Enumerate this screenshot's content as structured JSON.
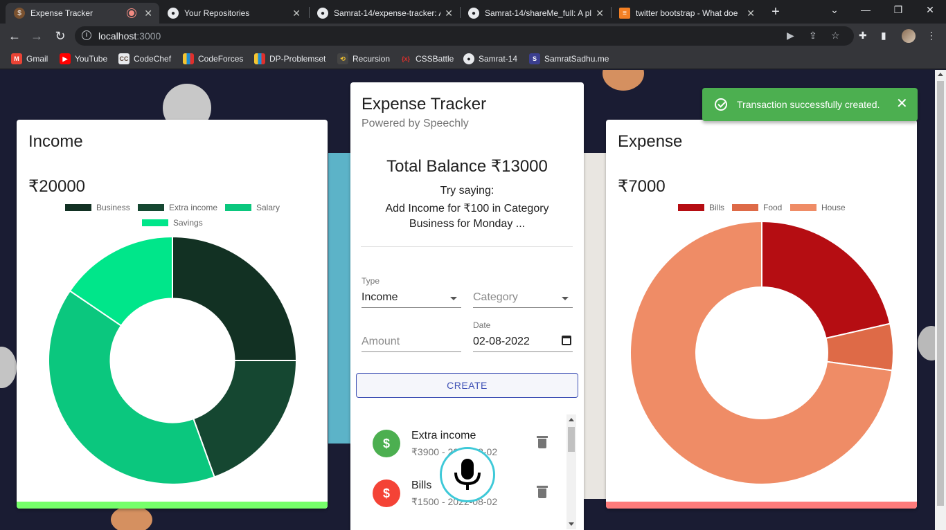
{
  "browser": {
    "tabs": [
      {
        "title": "Expense Tracker",
        "active": true
      },
      {
        "title": "Your Repositories"
      },
      {
        "title": "Samrat-14/expense-tracker: A"
      },
      {
        "title": "Samrat-14/shareMe_full: A pl"
      },
      {
        "title": "twitter bootstrap - What doe"
      }
    ],
    "url_host": "localhost",
    "url_port": ":3000",
    "bookmarks": [
      "Gmail",
      "YouTube",
      "CodeChef",
      "CodeForces",
      "DP-Problemset",
      "Recursion",
      "CSSBattle",
      "Samrat-14",
      "SamratSadhu.me"
    ]
  },
  "income": {
    "title": "Income",
    "amount": "₹20000",
    "bar_color": "#76ff6a"
  },
  "expense": {
    "title": "Expense",
    "amount": "₹7000",
    "bar_color": "#ff7b7b"
  },
  "main": {
    "title": "Expense Tracker",
    "subtitle": "Powered by Speechly",
    "balance": "Total Balance ₹13000",
    "try_line1": "Try saying:",
    "try_line2": "Add Income for ₹100 in Category",
    "try_line3": "Business for Monday ...",
    "type_label": "Type",
    "type_value": "Income",
    "category_placeholder": "Category",
    "amount_placeholder": "Amount",
    "date_label": "Date",
    "date_value": "02-08-2022",
    "create_label": "CREATE",
    "transactions": [
      {
        "name": "Extra income",
        "meta": "₹3900 - 2022-08-02",
        "color": "#4caf50",
        "icon": "dollar-off-icon"
      },
      {
        "name": "Bills",
        "meta": "₹1500 - 2022-08-02",
        "color": "#f44336",
        "icon": "dollar-off-icon"
      }
    ]
  },
  "snackbar": {
    "message": "Transaction successfully created."
  },
  "chart_data": [
    {
      "type": "pie",
      "title": "Income",
      "categories": [
        "Business",
        "Extra income",
        "Salary",
        "Savings"
      ],
      "values": [
        5000,
        3900,
        8000,
        3100
      ],
      "colors": [
        "#123123",
        "#154731",
        "#0bc77e",
        "#00e68a"
      ]
    },
    {
      "type": "pie",
      "title": "Expense",
      "categories": [
        "Bills",
        "Food",
        "House"
      ],
      "values": [
        1500,
        400,
        5100
      ],
      "colors": [
        "#b50d12",
        "#de6a47",
        "#ef8c66"
      ]
    }
  ]
}
